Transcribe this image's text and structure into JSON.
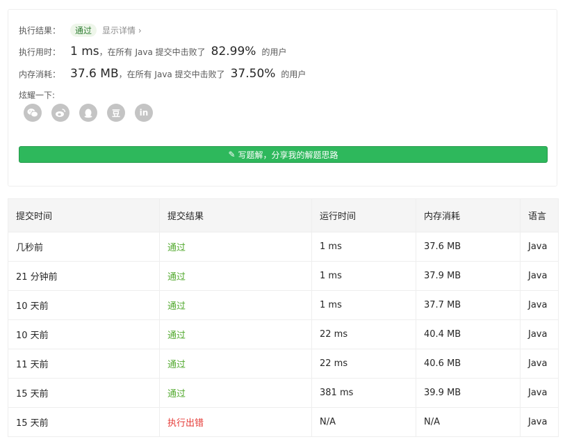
{
  "result": {
    "label": "执行结果：",
    "status": "通过",
    "details_link": "显示详情 ›"
  },
  "runtime": {
    "label": "执行用时：",
    "value": "1 ms",
    "prefix": "，在所有 Java 提交中击败了",
    "percent": "82.99%",
    "suffix": "的用户"
  },
  "memory": {
    "label": "内存消耗：",
    "value": "37.6 MB",
    "prefix": "，在所有 Java 提交中击败了",
    "percent": "37.50%",
    "suffix": "的用户"
  },
  "share": {
    "label": "炫耀一下:",
    "icons": [
      "wechat-icon",
      "weibo-icon",
      "qq-icon",
      "douban-icon",
      "linkedin-icon"
    ],
    "douban_glyph": "豆",
    "linkedin_glyph": "in",
    "button_label": "写题解，分享我的解题思路"
  },
  "table": {
    "headers": [
      "提交时间",
      "提交结果",
      "运行时间",
      "内存消耗",
      "语言"
    ],
    "rows": [
      {
        "time": "几秒前",
        "result": "通过",
        "runtime": "1 ms",
        "memory": "37.6 MB",
        "lang": "Java"
      },
      {
        "time": "21 分钟前",
        "result": "通过",
        "runtime": "1 ms",
        "memory": "37.9 MB",
        "lang": "Java"
      },
      {
        "time": "10 天前",
        "result": "通过",
        "runtime": "1 ms",
        "memory": "37.7 MB",
        "lang": "Java"
      },
      {
        "time": "10 天前",
        "result": "通过",
        "runtime": "22 ms",
        "memory": "40.4 MB",
        "lang": "Java"
      },
      {
        "time": "11 天前",
        "result": "通过",
        "runtime": "22 ms",
        "memory": "40.6 MB",
        "lang": "Java"
      },
      {
        "time": "15 天前",
        "result": "通过",
        "runtime": "381 ms",
        "memory": "39.9 MB",
        "lang": "Java"
      },
      {
        "time": "15 天前",
        "result": "执行出错",
        "runtime": "N/A",
        "memory": "N/A",
        "lang": "Java"
      }
    ]
  },
  "colors": {
    "pass": "#52a92e",
    "error": "#e53935",
    "accent": "#2eb85c"
  }
}
